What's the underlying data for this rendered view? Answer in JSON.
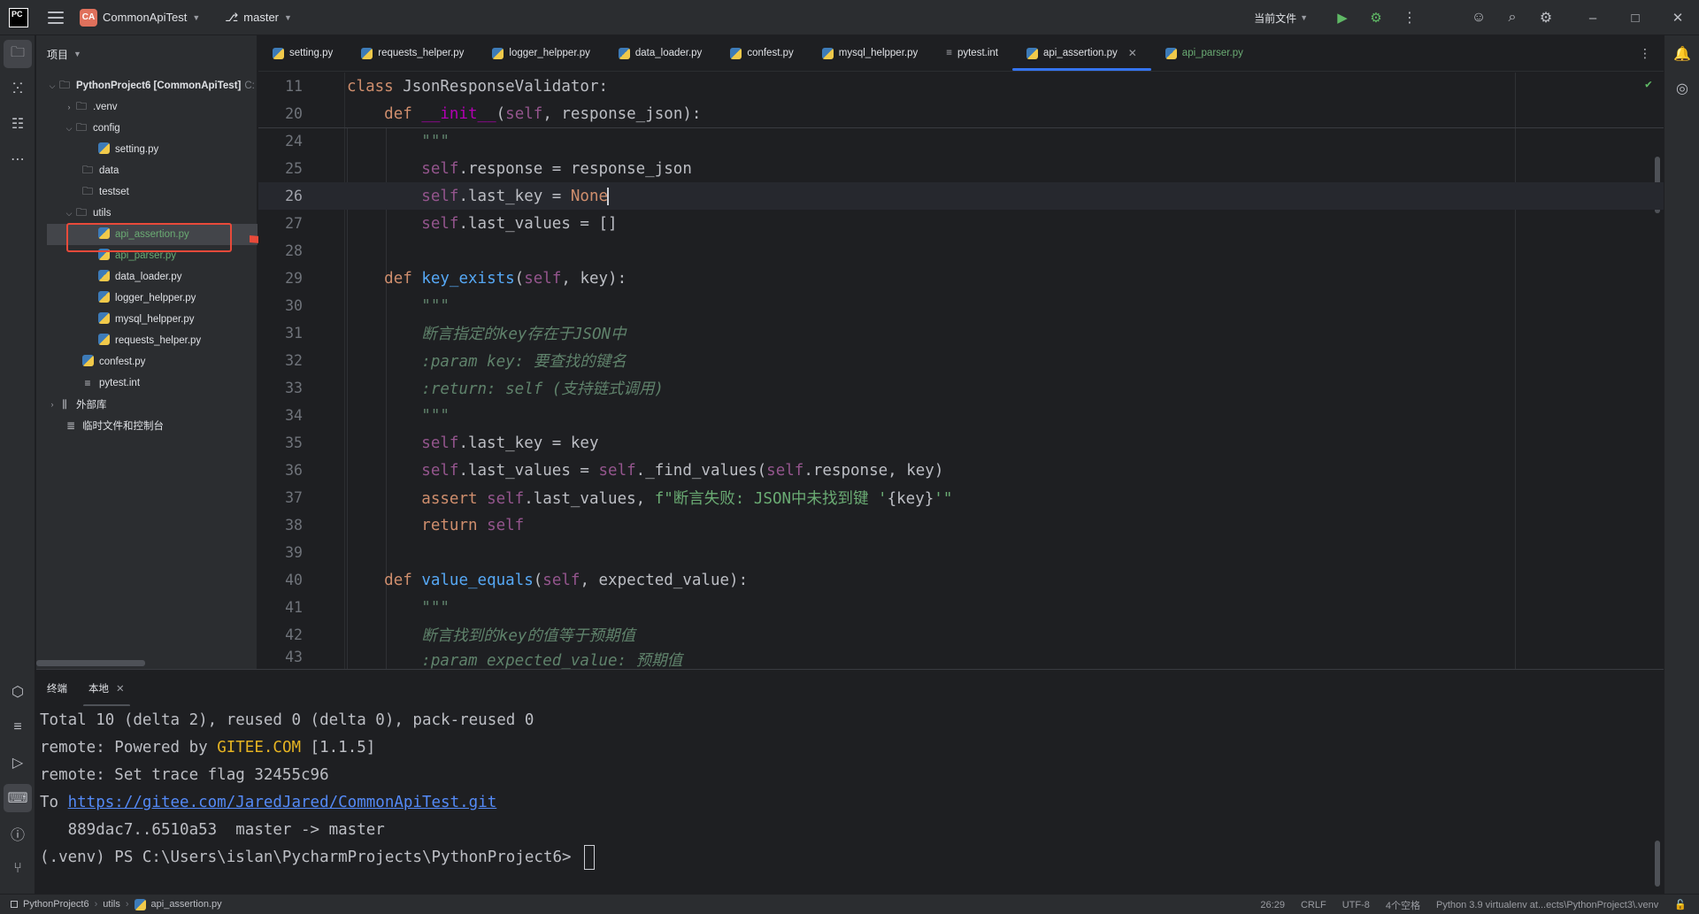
{
  "titlebar": {
    "logo": "PC",
    "project_badge": "CA",
    "project_name": "CommonApiTest",
    "branch": "master",
    "run_config": "当前文件"
  },
  "project_panel": {
    "title": "项目",
    "tree": [
      {
        "label": "PythonProject6 [CommonApiTest]",
        "suffix": "C:",
        "type": "root"
      },
      {
        "label": ".venv",
        "type": "folder"
      },
      {
        "label": "config",
        "type": "folder"
      },
      {
        "label": "setting.py",
        "type": "py"
      },
      {
        "label": "data",
        "type": "folder"
      },
      {
        "label": "testset",
        "type": "folder"
      },
      {
        "label": "utils",
        "type": "folder"
      },
      {
        "label": "api_assertion.py",
        "type": "py"
      },
      {
        "label": "api_parser.py",
        "type": "py"
      },
      {
        "label": "data_loader.py",
        "type": "py"
      },
      {
        "label": "logger_helpper.py",
        "type": "py"
      },
      {
        "label": "mysql_helpper.py",
        "type": "py"
      },
      {
        "label": "requests_helper.py",
        "type": "py"
      },
      {
        "label": "confest.py",
        "type": "py"
      },
      {
        "label": "pytest.int",
        "type": "ini"
      },
      {
        "label": "外部库",
        "type": "lib"
      },
      {
        "label": "临时文件和控制台",
        "type": "scratch"
      }
    ]
  },
  "tabs": [
    {
      "label": "setting.py"
    },
    {
      "label": "requests_helper.py"
    },
    {
      "label": "logger_helpper.py"
    },
    {
      "label": "data_loader.py"
    },
    {
      "label": "confest.py"
    },
    {
      "label": "mysql_helpper.py"
    },
    {
      "label": "pytest.int"
    },
    {
      "label": "api_assertion.py"
    },
    {
      "label": "api_parser.py"
    }
  ],
  "editor": {
    "line_numbers": [
      "11",
      "20",
      "24",
      "25",
      "26",
      "27",
      "28",
      "29",
      "30",
      "31",
      "32",
      "33",
      "34",
      "35",
      "36",
      "37",
      "38",
      "39",
      "40",
      "41",
      "42",
      "43"
    ],
    "code": {
      "l11_kw": "class",
      "l11_rest": " JsonResponseValidator:",
      "l20_def": "def",
      "l20_name": "__init__",
      "l20_self": "self",
      "l20_rest": ", response_json):",
      "l24": "\"\"\"",
      "l25_self": "self",
      "l25_rest": ".response = response_json",
      "l26_self": "self",
      "l26_rest": ".last_key = ",
      "l26_none": "None",
      "l27_self": "self",
      "l27_rest": ".last_values = []",
      "l29_def": "def",
      "l29_name": "key_exists",
      "l29_self": "self",
      "l29_rest": ", key):",
      "l30": "\"\"\"",
      "l31": "断言指定的key存在于JSON中",
      "l32": ":param key: 要查找的键名",
      "l33": ":return: self (支持链式调用)",
      "l34": "\"\"\"",
      "l35_self": "self",
      "l35_rest": ".last_key = key",
      "l36_self1": "self",
      "l36_mid1": ".last_values = ",
      "l36_self2": "self",
      "l36_mid2": "._find_values(",
      "l36_self3": "self",
      "l36_rest": ".response, key)",
      "l37_kw": "assert",
      "l37_self": "self",
      "l37_mid": ".last_values, ",
      "l37_str1": "f\"断言失败: JSON中未找到键 '",
      "l37_expr": "{key}",
      "l37_str2": "'\"",
      "l38_kw": "return",
      "l38_self": "self",
      "l40_def": "def",
      "l40_name": "value_equals",
      "l40_self": "self",
      "l40_rest": ", expected_value):",
      "l41": "\"\"\"",
      "l42": "断言找到的key的值等于预期值",
      "l43": ":param expected_value: 预期值"
    }
  },
  "terminal": {
    "tab_title": "终端",
    "tab_local": "本地",
    "lines": {
      "t1": "Total 10 (delta 2), reused 0 (delta 0), pack-reused 0",
      "t2_a": "remote: Powered by ",
      "t2_b": "GITEE.COM",
      "t2_c": " [1.1.5]",
      "t3": "remote: Set trace flag 32455c96",
      "t4_a": "To ",
      "t4_link": "https://gitee.com/JaredJared/CommonApiTest.git",
      "t5": "   889dac7..6510a53  master -> master",
      "t6": "(.venv) PS C:\\Users\\islan\\PycharmProjects\\PythonProject6> "
    }
  },
  "statusbar": {
    "crumb1": "PythonProject6",
    "crumb2": "utils",
    "crumb3": "api_assertion.py",
    "position": "26:29",
    "line_sep": "CRLF",
    "encoding": "UTF-8",
    "indent": "4个空格",
    "interpreter": "Python 3.9 virtualenv at...ects\\PythonProject3\\.venv"
  },
  "colors": {
    "background": "#1e1f22",
    "panel": "#2b2d30",
    "accent": "#3574f0",
    "annotation_red": "#e84a3a"
  }
}
